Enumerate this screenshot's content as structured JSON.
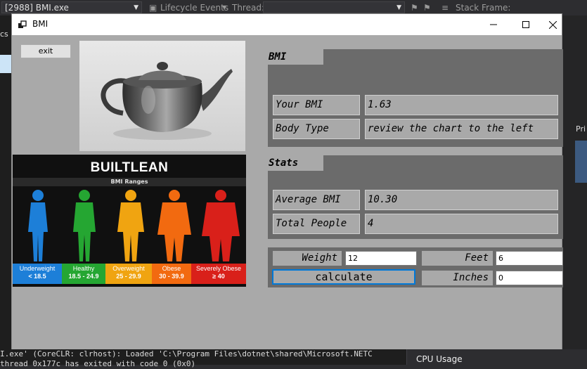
{
  "ide": {
    "process_combo": "[2988] BMI.exe",
    "lifecycle_label": "Lifecycle Events",
    "thread_label": "Thread:",
    "stackframe_label": "Stack Frame:",
    "output_line1": "I.exe' (CoreCLR: clrhost): Loaded 'C:\\Program Files\\dotnet\\shared\\Microsoft.NETC",
    "output_line2": "thread 0x177c has exited with code 0 (0x0)",
    "cpu_usage": "CPU Usage",
    "side_text": "Pri",
    "left_text": "cs"
  },
  "window": {
    "title": "BMI",
    "exit_label": "exit"
  },
  "image_chart": {
    "brand": "BUILTLEAN",
    "subtitle": "BMI Ranges",
    "categories": [
      {
        "name": "Underweight",
        "range": "< 18.5",
        "color": "#1d7fd8"
      },
      {
        "name": "Healthy",
        "range": "18.5 - 24.9",
        "color": "#25a632"
      },
      {
        "name": "Overweight",
        "range": "25 - 29.9",
        "color": "#f0a411"
      },
      {
        "name": "Obese",
        "range": "30 - 39.9",
        "color": "#f26a10"
      },
      {
        "name": "Severely Obese",
        "range": "≥ 40",
        "color": "#d9201a"
      }
    ]
  },
  "bmi_panel": {
    "title": "BMI",
    "your_bmi_label": "Your BMI",
    "your_bmi_value": "1.63",
    "body_type_label": "Body Type",
    "body_type_value": "review the chart to the left"
  },
  "stats_panel": {
    "title": "Stats",
    "avg_label": "Average BMI",
    "avg_value": "10.30",
    "total_label": "Total People",
    "total_value": "4"
  },
  "inputs": {
    "weight_label": "Weight",
    "weight_value": "12",
    "feet_label": "Feet",
    "feet_value": "6",
    "inches_label": "Inches",
    "inches_value": "0",
    "calculate_label": "calculate"
  }
}
